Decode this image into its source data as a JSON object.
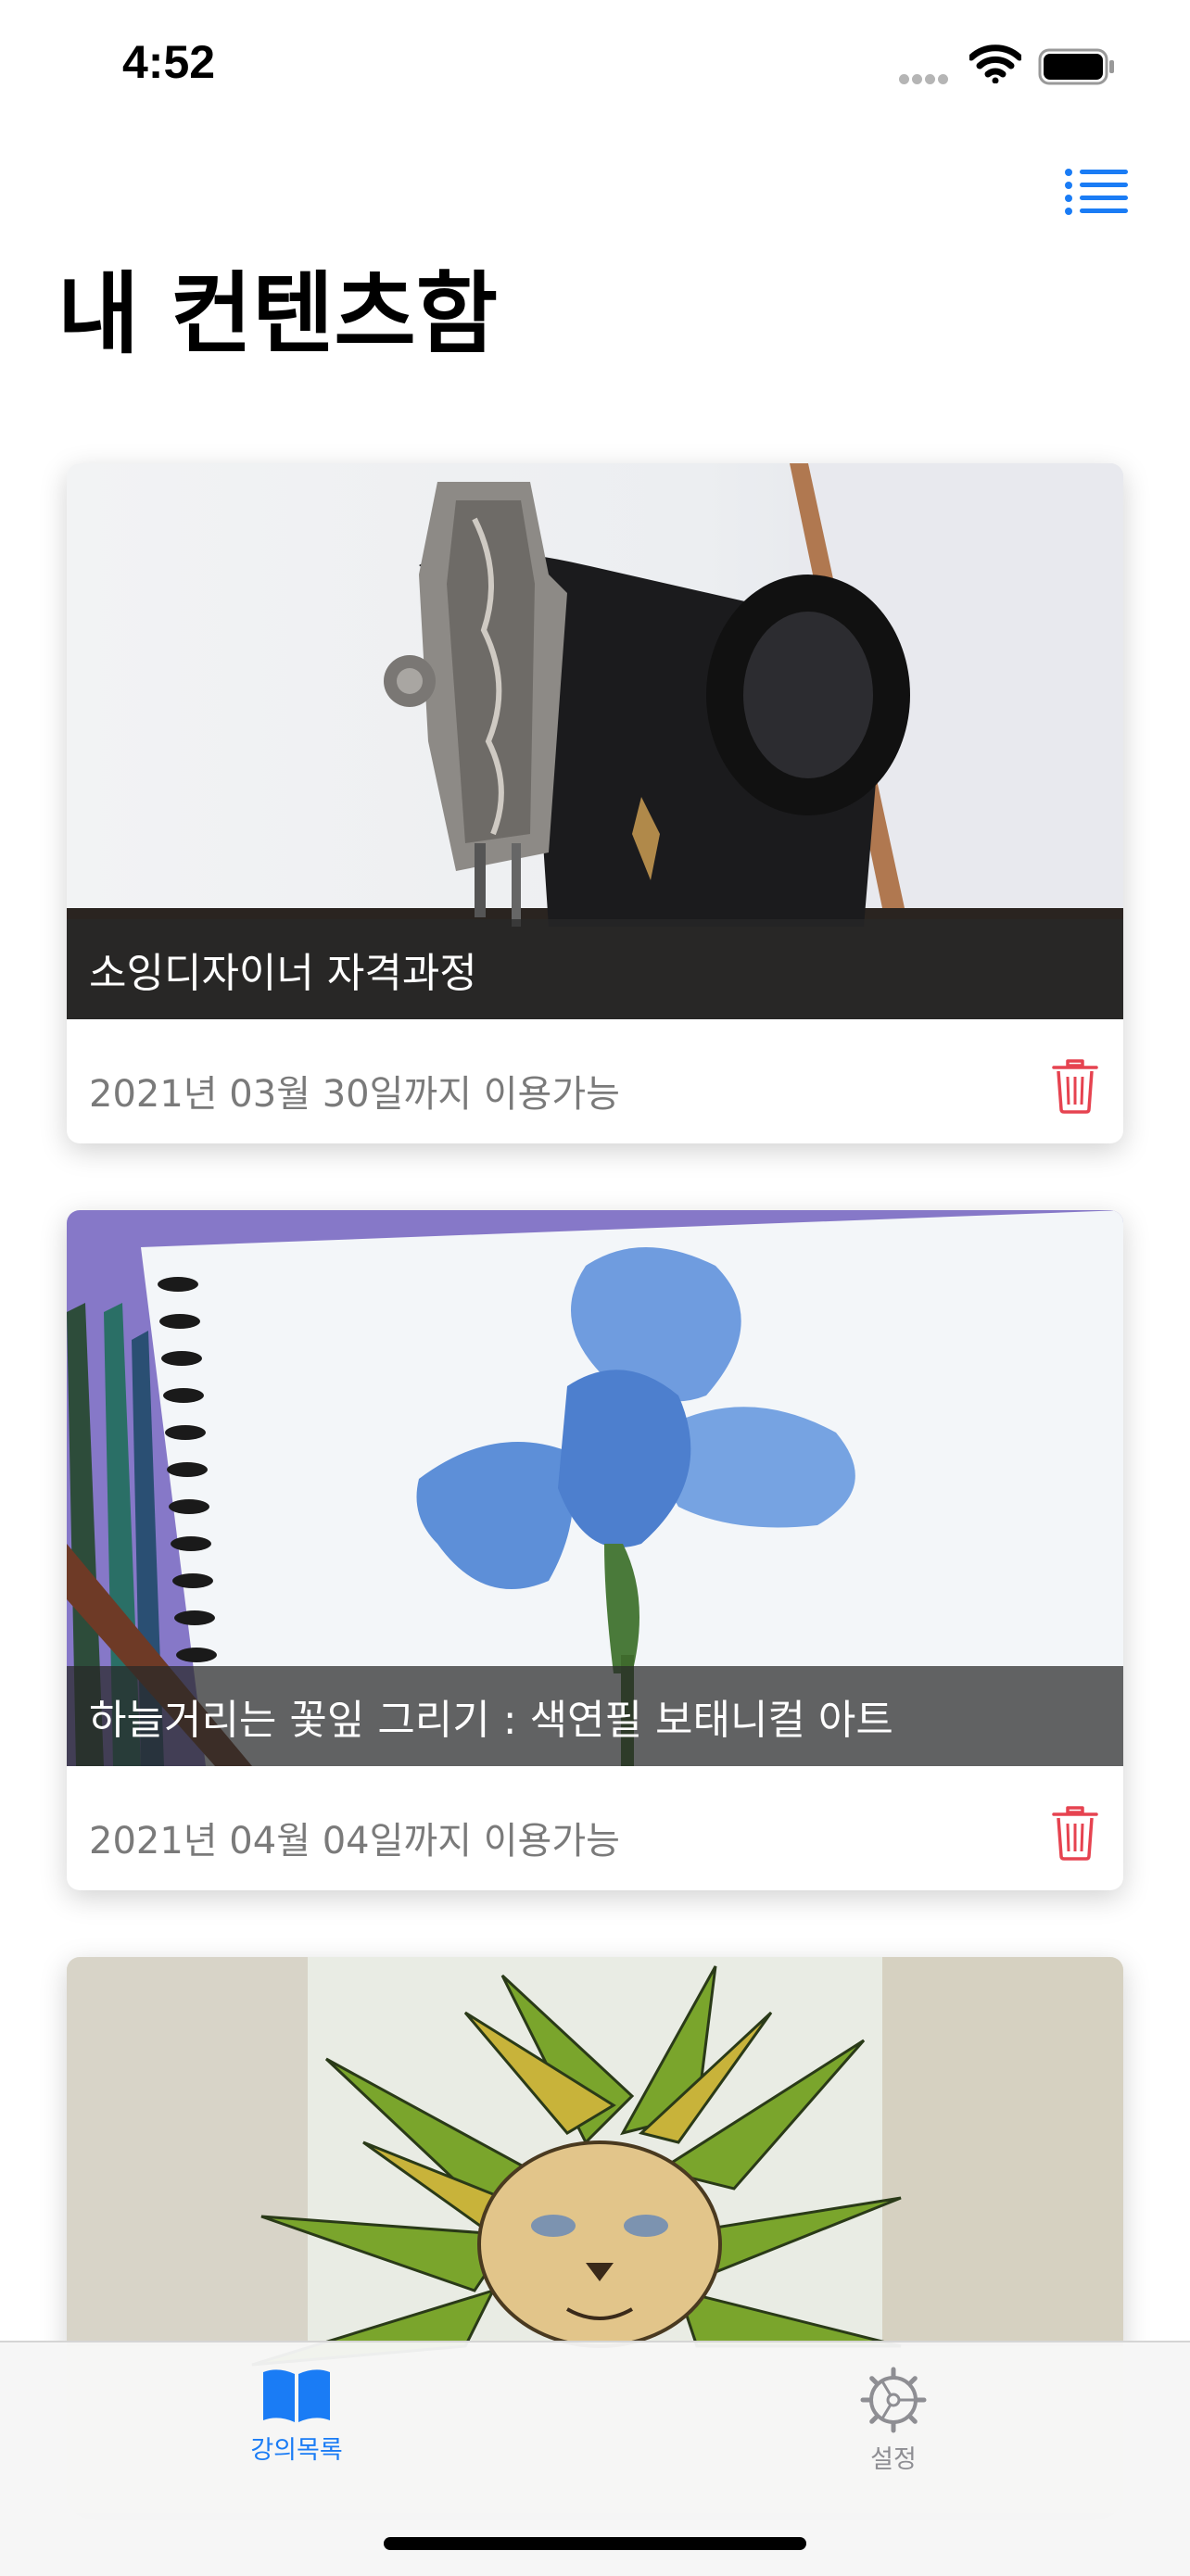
{
  "status": {
    "time": "4:52"
  },
  "header": {
    "title": "내 컨텐츠함",
    "menu_icon": "list-icon"
  },
  "colors": {
    "accent": "#1a7cf5",
    "delete": "#e64350",
    "meta_text": "#7a7a7a",
    "inactive_tab": "#8e8e93"
  },
  "courses": [
    {
      "title": "소잉디자이너 자격과정",
      "expiry": "2021년 03월 30일까지 이용가능",
      "image": "vintage-sewing-machine-photo",
      "delete_icon": "trash-icon"
    },
    {
      "title": "하늘거리는 꽃잎 그리기 : 색연필 보태니컬 아트",
      "expiry": "2021년 04월 04일까지 이용가능",
      "image": "blue-iris-drawing-photo",
      "delete_icon": "trash-icon"
    },
    {
      "title": "",
      "expiry": "",
      "image": "lion-mandala-illustration-photo"
    }
  ],
  "tabs": [
    {
      "label": "강의목록",
      "icon": "book-icon",
      "active": true
    },
    {
      "label": "설정",
      "icon": "gear-icon",
      "active": false
    }
  ]
}
